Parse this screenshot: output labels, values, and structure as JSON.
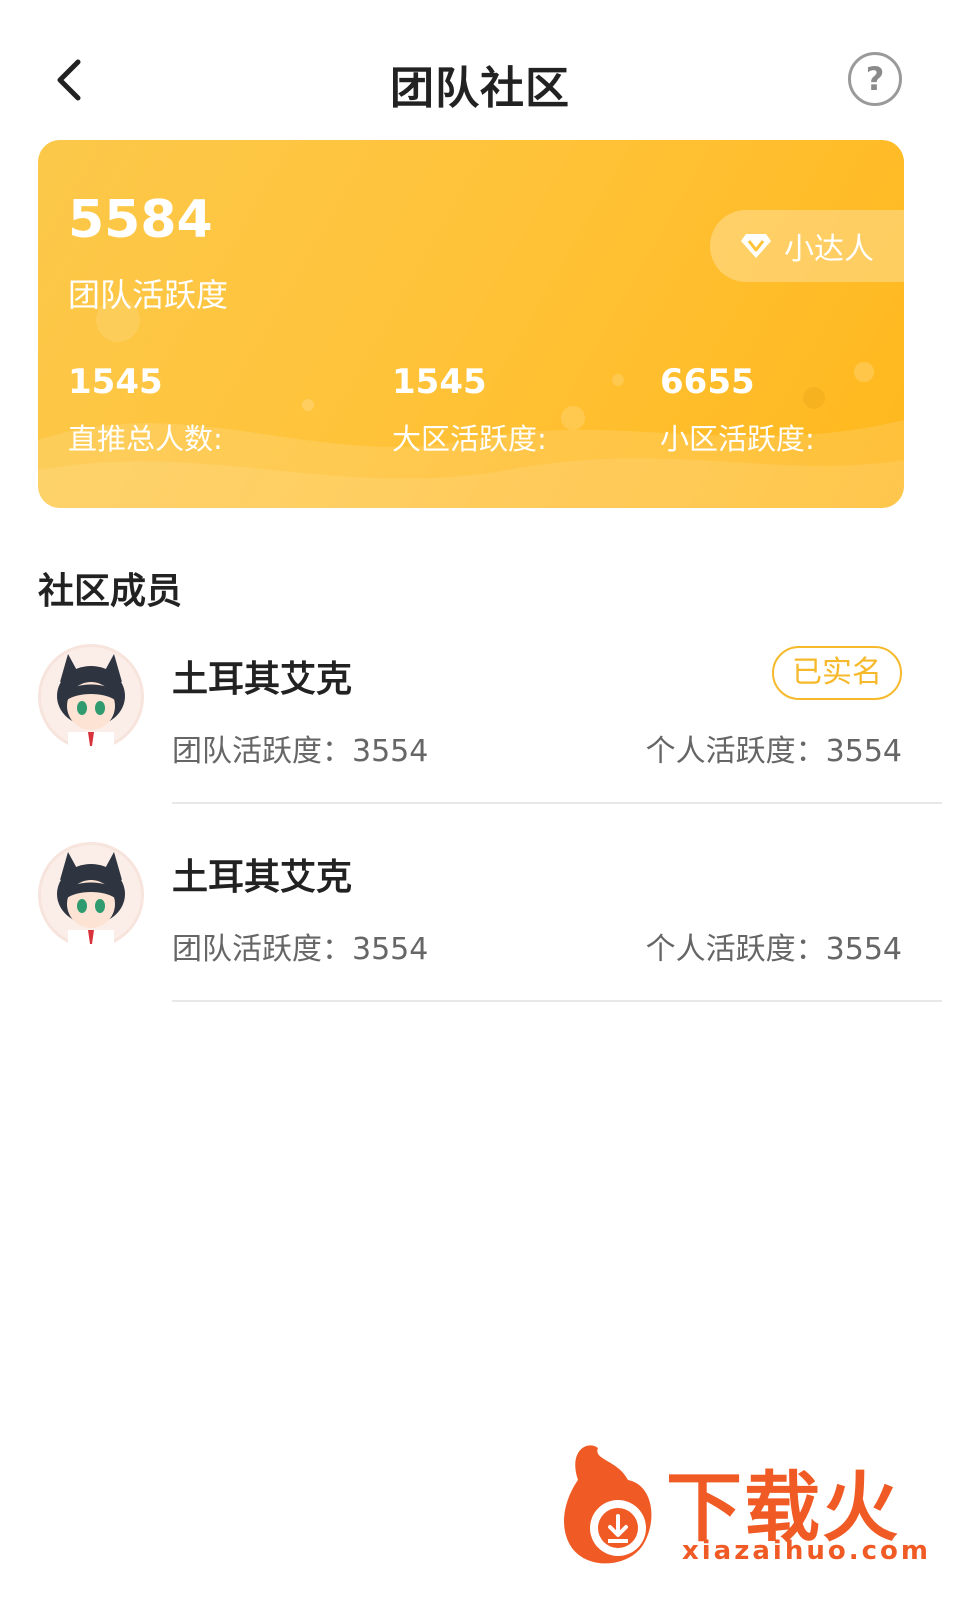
{
  "header": {
    "title": "团队社区",
    "help_symbol": "?"
  },
  "hero": {
    "team_activity_value": "5584",
    "team_activity_label": "团队活跃度",
    "level_badge": "小达人",
    "stats": [
      {
        "value": "1545",
        "label": "直推总人数:"
      },
      {
        "value": "1545",
        "label": "大区活跃度:"
      },
      {
        "value": "6655",
        "label": "小区活跃度:"
      }
    ],
    "colors": {
      "gradient_start": "#fcc84a",
      "gradient_end": "#ffb81d"
    }
  },
  "members_section": {
    "title": "社区成员",
    "members": [
      {
        "name": "土耳其艾克",
        "team_activity": "团队活跃度：3554",
        "personal_activity": "个人活跃度：3554",
        "badge": "已实名"
      },
      {
        "name": "土耳其艾克",
        "team_activity": "团队活跃度：3554",
        "personal_activity": "个人活跃度：3554",
        "badge": ""
      }
    ]
  },
  "watermark": {
    "brand": "下载火",
    "url": "xiazaihuo.com",
    "color": "#f05a25"
  }
}
